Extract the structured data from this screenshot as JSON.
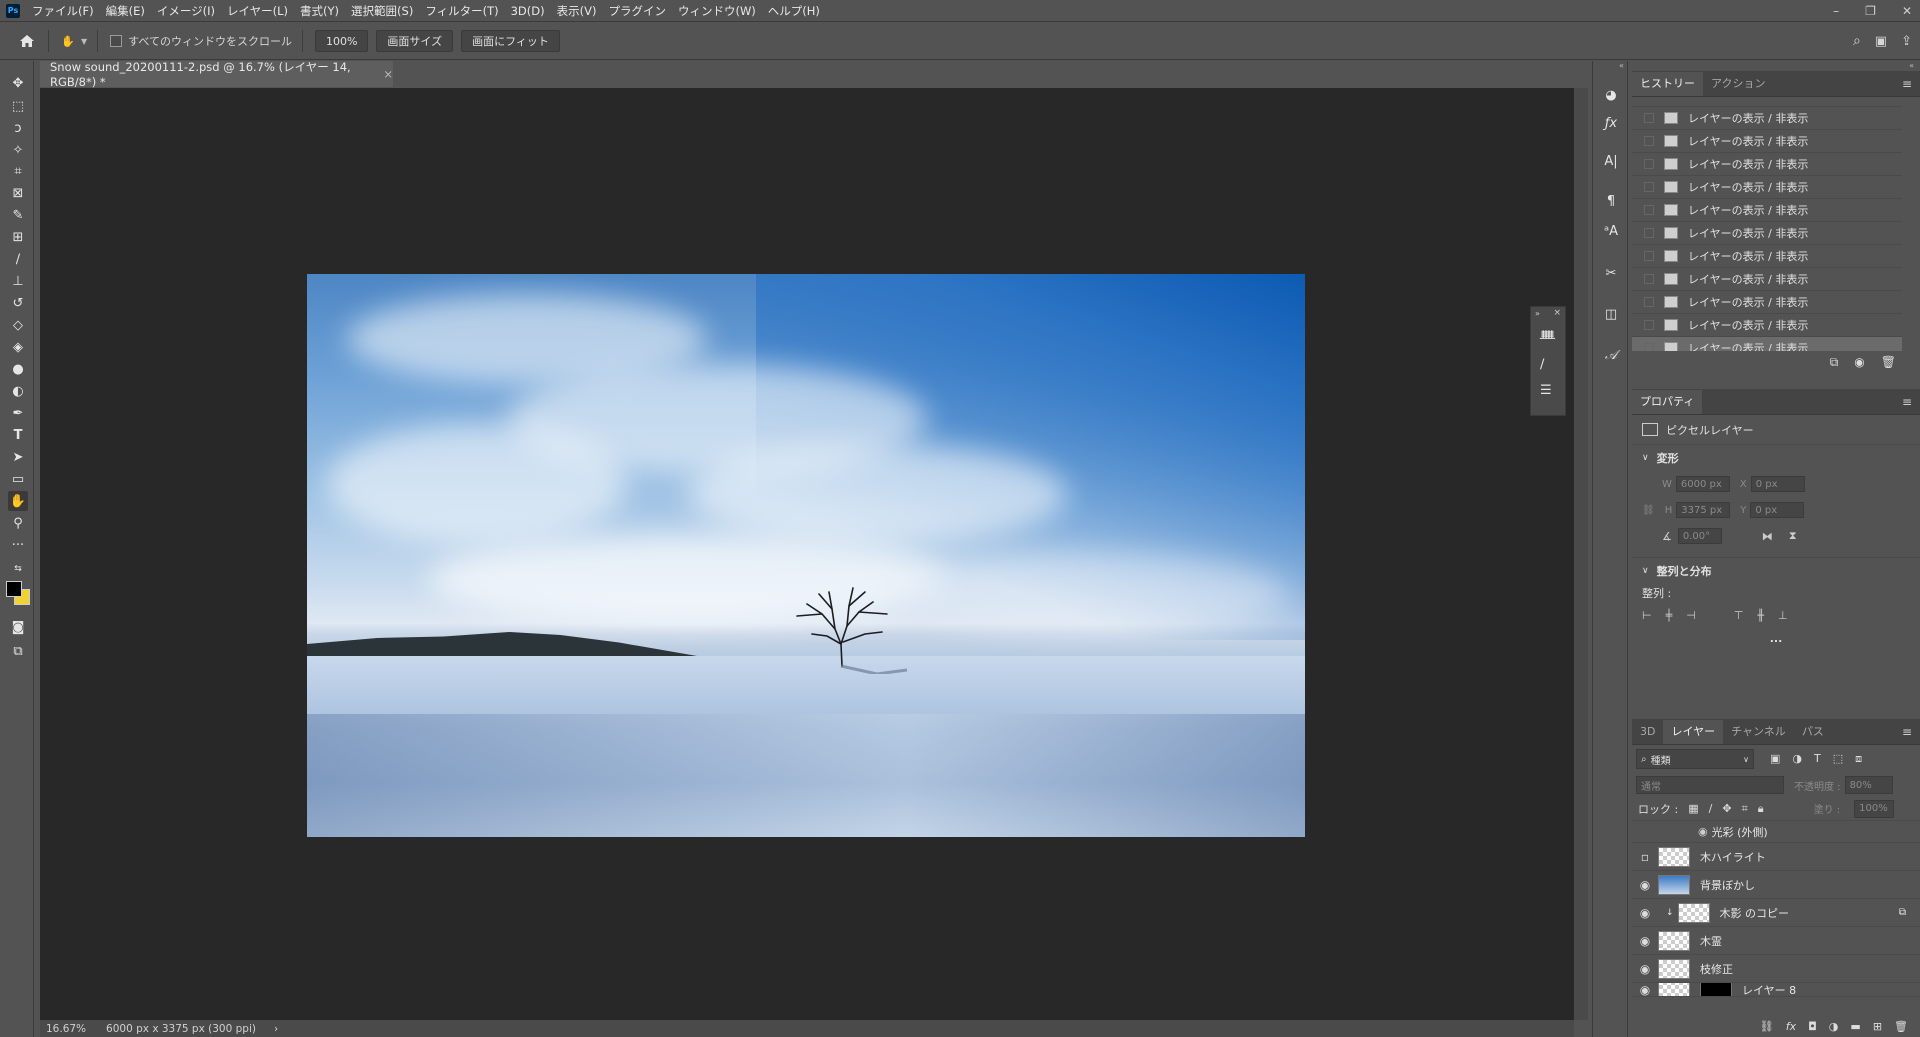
{
  "app": {
    "logo": "Ps",
    "menu": [
      "ファイル(F)",
      "編集(E)",
      "イメージ(I)",
      "レイヤー(L)",
      "書式(Y)",
      "選択範囲(S)",
      "フィルター(T)",
      "3D(D)",
      "表示(V)",
      "プラグイン",
      "ウィンドウ(W)",
      "ヘルプ(H)"
    ],
    "window_controls": [
      "–",
      "❐",
      "✕"
    ]
  },
  "options": {
    "scroll_all_label": "すべてのウィンドウをスクロール",
    "zoom_value": "100%",
    "screen_size_label": "画面サイズ",
    "fit_screen_label": "画面にフィット"
  },
  "document": {
    "tab_title": "Snow sound_20200111-2.psd @ 16.7% (レイヤー 14, RGB/8*) *",
    "zoom": "16.67%",
    "size_info": "6000 px x 3375 px (300 ppi)"
  },
  "history": {
    "tabs": [
      "ヒストリー",
      "アクション"
    ],
    "items": [
      "レイヤーの表示 / 非表示",
      "レイヤーの表示 / 非表示",
      "レイヤーの表示 / 非表示",
      "レイヤーの表示 / 非表示",
      "レイヤーの表示 / 非表示",
      "レイヤーの表示 / 非表示",
      "レイヤーの表示 / 非表示",
      "レイヤーの表示 / 非表示",
      "レイヤーの表示 / 非表示",
      "レイヤーの表示 / 非表示",
      "レイヤーの表示 / 非表示"
    ]
  },
  "properties": {
    "tab": "プロパティ",
    "layer_type": "ピクセルレイヤー",
    "transform_title": "変形",
    "w_label": "W",
    "w_value": "6000 px",
    "x_label": "X",
    "x_value": "0 px",
    "h_label": "H",
    "h_value": "3375 px",
    "y_label": "Y",
    "y_value": "0 px",
    "angle_value": "0.00°",
    "align_title": "整列と分布",
    "align_label": "整列 :",
    "more": "..."
  },
  "layers": {
    "tabs": [
      "3D",
      "レイヤー",
      "チャンネル",
      "パス"
    ],
    "filter_kind": "種類",
    "blend_mode": "通常",
    "opacity_label": "不透明度 :",
    "opacity_value": "80%",
    "lock_label": "ロック :",
    "fill_label": "塗り :",
    "fill_value": "100%",
    "effect": "光彩 (外側)",
    "rows": [
      {
        "name": "木ハイライト",
        "visible": false
      },
      {
        "name": "背景ぼかし",
        "visible": true
      },
      {
        "name": "木影 のコピー",
        "visible": true
      },
      {
        "name": "木霊",
        "visible": true
      },
      {
        "name": "枝修正",
        "visible": true
      },
      {
        "name": "レイヤー 8",
        "visible": true
      }
    ]
  },
  "colors": {
    "foreground": "#000000",
    "background": "#f2d230",
    "accent": "#31a8ff"
  }
}
